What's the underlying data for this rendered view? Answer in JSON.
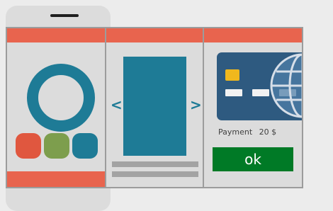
{
  "payment": {
    "label": "Payment",
    "amount": "20 $",
    "ok_label": "ok"
  },
  "carousel": {
    "prev_arrow": "<",
    "next_arrow": ">"
  },
  "icons": {
    "ring": "ring-icon",
    "card": "credit-card-icon",
    "globe": "globe-icon",
    "chip": "chip-icon"
  },
  "colors": {
    "header_red": "#e8644e",
    "teal": "#1e7b96",
    "green": "#7d9e4d",
    "orange": "#e0573f",
    "card_blue": "#2e5a80",
    "ok_green": "#007a26",
    "chip_yellow": "#f0b81d"
  }
}
